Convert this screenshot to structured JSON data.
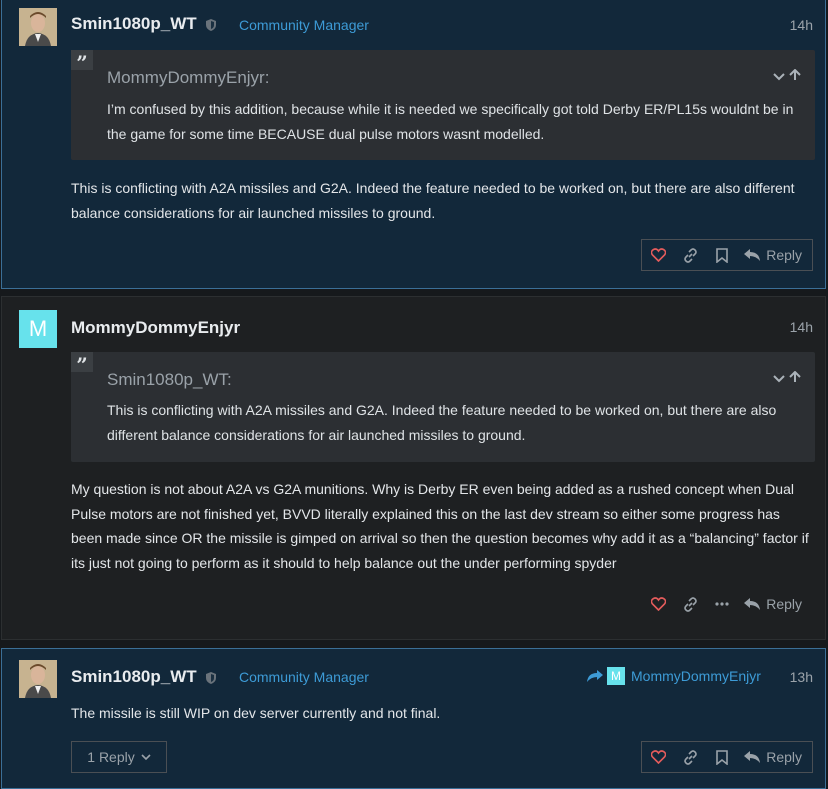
{
  "posts": [
    {
      "username": "Smin1080p_WT",
      "user_title": "Community Manager",
      "time": "14h",
      "quote": {
        "author": "MommyDommyEnjyr:",
        "text": "I’m confused by this addition, because while it is needed we specifically got told Derby ER/PL15s wouldnt be in the game for some time BECAUSE dual pulse motors wasnt modelled."
      },
      "body": "This is conflicting with A2A missiles and G2A. Indeed the feature needed to be worked on, but there are also different balance considerations for air launched missiles to ground.",
      "reply_label": "Reply"
    },
    {
      "username": "MommyDommyEnjyr",
      "avatar_letter": "M",
      "time": "14h",
      "quote": {
        "author": "Smin1080p_WT:",
        "text": "This is conflicting with A2A missiles and G2A. Indeed the feature needed to be worked on, but there are also different balance considerations for air launched missiles to ground."
      },
      "body": "My question is not about A2A vs G2A munitions. Why is Derby ER even being added as a rushed concept when Dual Pulse motors are not finished yet, BVVD literally explained this on the last dev stream so either some progress has been made since OR the missile is gimped on arrival so then the question becomes why add it as a “balancing” factor if its just not going to perform as it should to help balance out the under performing spyder",
      "reply_label": "Reply"
    },
    {
      "username": "Smin1080p_WT",
      "user_title": "Community Manager",
      "time": "13h",
      "reply_to": "MommyDommyEnjyr",
      "reply_to_letter": "M",
      "body": "The missile is still WIP on dev server currently and not final.",
      "replies_label": "1 Reply",
      "reply_label": "Reply"
    }
  ],
  "colors": {
    "accent": "#3d9bd6",
    "heart": "#e45c5c",
    "avatar_m": "#67e2ec"
  },
  "icons": [
    "heart-icon",
    "link-icon",
    "bookmark-icon",
    "reply-arrow-icon",
    "more-icon",
    "shield-icon",
    "chevron-down-icon",
    "arrow-up-icon",
    "quote-icon"
  ]
}
